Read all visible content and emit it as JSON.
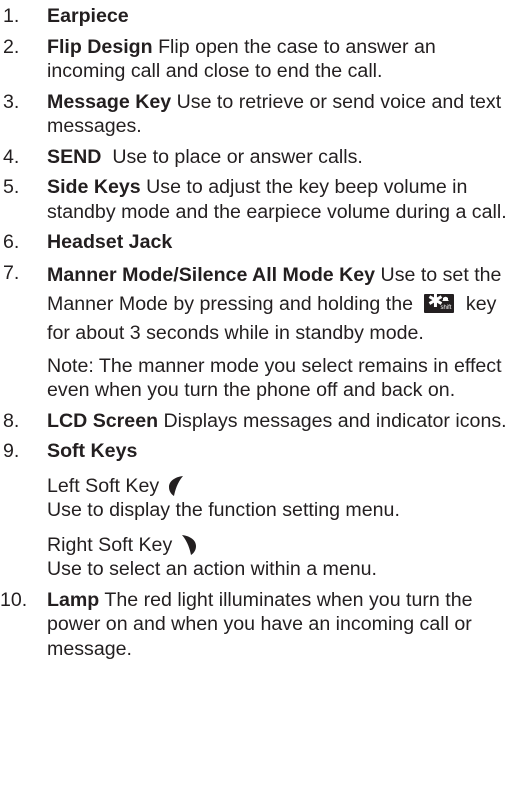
{
  "items": [
    {
      "num": "1.",
      "title": "Earpiece",
      "desc": ""
    },
    {
      "num": "2.",
      "title": "Flip Design",
      "desc": "Flip open the case to answer an incoming call and close to end the call."
    },
    {
      "num": "3.",
      "title": "Message Key",
      "desc": "Use to retrieve or send voice and text messages."
    },
    {
      "num": "4.",
      "title": "SEND",
      "desc": "Use to place or answer calls."
    },
    {
      "num": "5.",
      "title": "Side Keys",
      "desc": "Use to adjust the key beep volume in standby mode and the earpiece volume during a call."
    },
    {
      "num": "6.",
      "title": "Headset Jack",
      "desc": ""
    },
    {
      "num": "7.",
      "title": "Manner Mode/Silence All Mode Key",
      "desc_a": "Use to set the Manner Mode by pressing and holding the",
      "desc_b": "key for about 3 seconds while in standby mode.",
      "key_star": "✱",
      "key_shift": "shift",
      "key_icon": "star-shift-key-icon",
      "note": "Note: The manner mode you select remains in effect even when you turn the phone off and back on."
    },
    {
      "num": "8.",
      "title": "LCD Screen",
      "desc": "Displays messages and indicator icons."
    },
    {
      "num": "9.",
      "title": "Soft Keys",
      "left_label": "Left Soft Key",
      "left_desc": "Use to display the function setting menu.",
      "left_icon": "left-soft-key-icon",
      "right_label": "Right Soft Key",
      "right_desc": "Use to select an action within a menu.",
      "right_icon": "right-soft-key-icon"
    },
    {
      "num": "10.",
      "title": "Lamp",
      "desc": "The red light illuminates when you turn the power on and when you have an incoming call or message."
    }
  ]
}
